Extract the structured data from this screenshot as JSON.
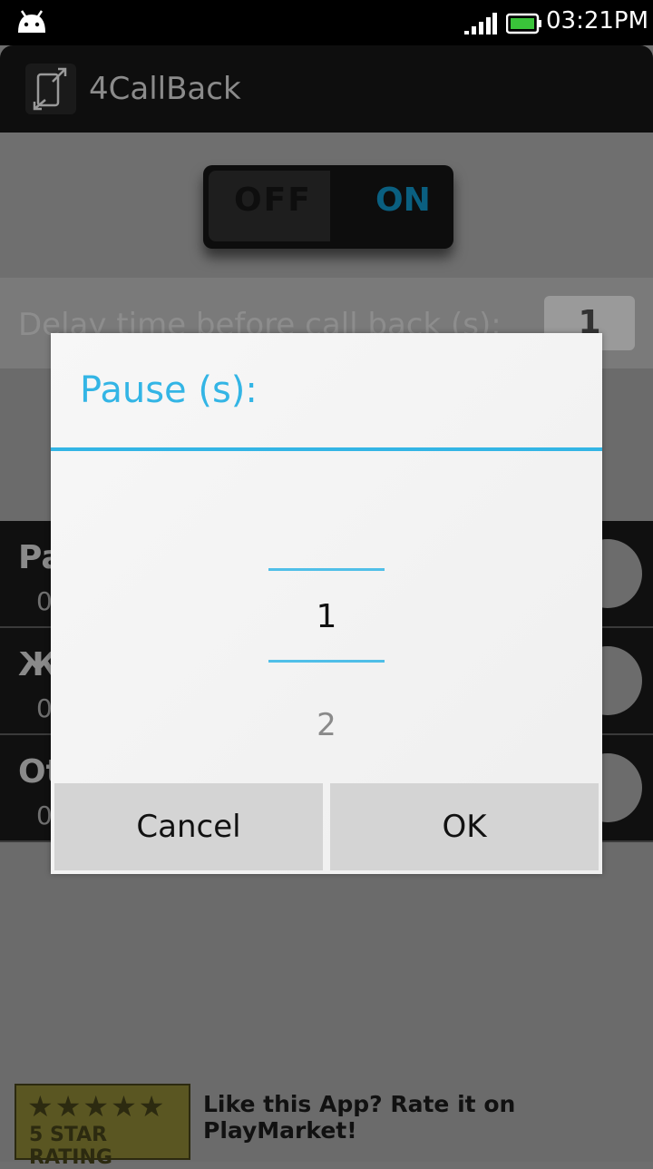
{
  "status_bar": {
    "time": "03:21PM"
  },
  "app_bar": {
    "title": "4CallBack"
  },
  "toggle": {
    "off_label": "OFF",
    "on_label": "ON",
    "state": "on"
  },
  "delay": {
    "label": "Delay time before call back (s):",
    "value": "1"
  },
  "list": {
    "items": [
      {
        "name": "Pa",
        "sub": "0"
      },
      {
        "name": "Ж",
        "sub": "0"
      },
      {
        "name": "Ot",
        "sub": "0"
      }
    ]
  },
  "dialog": {
    "title": "Pause (s):",
    "picker": {
      "current": "1",
      "next": "2"
    },
    "cancel_label": "Cancel",
    "ok_label": "OK"
  },
  "footer": {
    "badge_text": "5 STAR RATING",
    "badge_stars": "★★★★★",
    "rate_text": "Like this App? Rate it on PlayMarket!"
  },
  "colors": {
    "accent": "#33b5e5",
    "dialog_bg": "#f2f2f2",
    "button_bg": "#d4d4d4"
  }
}
